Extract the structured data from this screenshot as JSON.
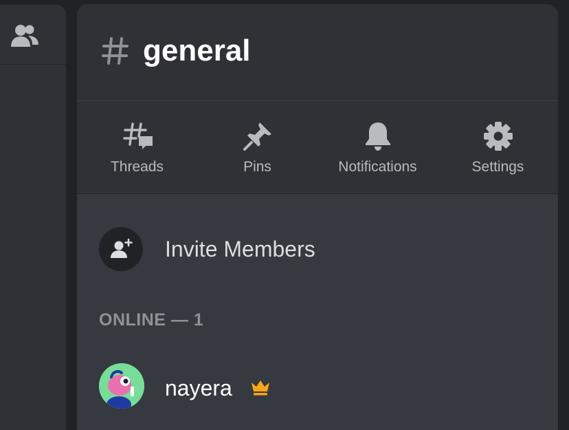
{
  "channel": {
    "name": "general"
  },
  "actions": [
    {
      "label": "Threads",
      "icon": "threads-icon"
    },
    {
      "label": "Pins",
      "icon": "pin-icon"
    },
    {
      "label": "Notifications",
      "icon": "bell-icon"
    },
    {
      "label": "Settings",
      "icon": "gear-icon"
    }
  ],
  "invite": {
    "label": "Invite Members",
    "icon": "add-user-icon"
  },
  "members_section": {
    "heading": "ONLINE — 1"
  },
  "members": [
    {
      "name": "nayera",
      "badge": "crown-icon",
      "badge_color": "#faa61a"
    }
  ],
  "colors": {
    "background": "#202225",
    "panel": "#36393f",
    "header": "#2f3136",
    "text_muted": "#b9bbbe",
    "crown": "#faa61a"
  }
}
